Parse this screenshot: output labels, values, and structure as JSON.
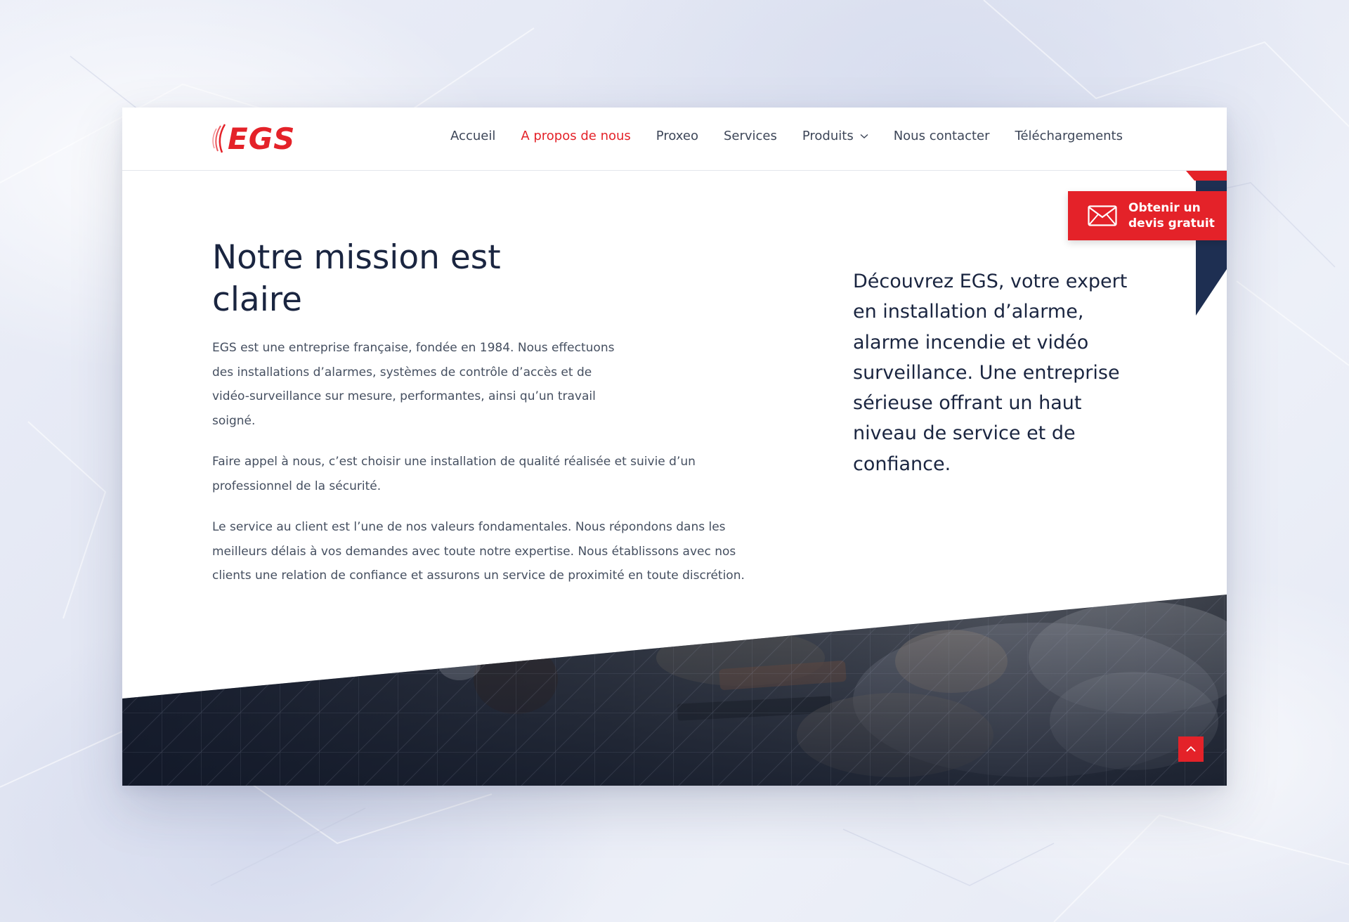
{
  "brand": {
    "logo_text": "EGS",
    "logo_color": "#e42229"
  },
  "nav": {
    "items": [
      {
        "label": "Accueil"
      },
      {
        "label": "A propos de nous"
      },
      {
        "label": "Proxeo"
      },
      {
        "label": "Services"
      },
      {
        "label": "Produits"
      },
      {
        "label": "Nous contacter"
      },
      {
        "label": "Téléchargements"
      }
    ],
    "active_item": "A propos de nous",
    "dropdown_icon": "chevron-down-icon"
  },
  "main": {
    "heading": "Notre mission est claire",
    "paragraphs": [
      "EGS est une entreprise française, fondée en 1984. Nous effectuons des installations d’alarmes, systèmes de contrôle d’accès et de vidéo-surveillance sur mesure, performantes, ainsi qu’un travail soigné.",
      "Faire appel à nous, c’est choisir une installation de qualité réalisée et suivie d’un professionnel de la sécurité.",
      "Le service au client est l’une de nos valeurs fondamentales. Nous répondons dans les meilleurs délais à vos demandes avec toute notre expertise. Nous établissons avec nos clients une relation de confiance et assurons un service de proximité en toute discrétion."
    ],
    "lead": "Découvrez EGS, votre expert en installation d’alarme, alarme incendie et vidéo surveillance. Une entreprise sérieuse offrant un haut niveau de service et de confiance."
  },
  "cta": {
    "label": "Obtenir un devis gratuit",
    "icon": "envelope-icon"
  },
  "scroll_top": {
    "icon": "chevron-up-icon"
  },
  "colors": {
    "accent": "#e42229",
    "navy": "#1e2f52",
    "text_dark": "#1a2540",
    "text_body": "#454f60"
  }
}
